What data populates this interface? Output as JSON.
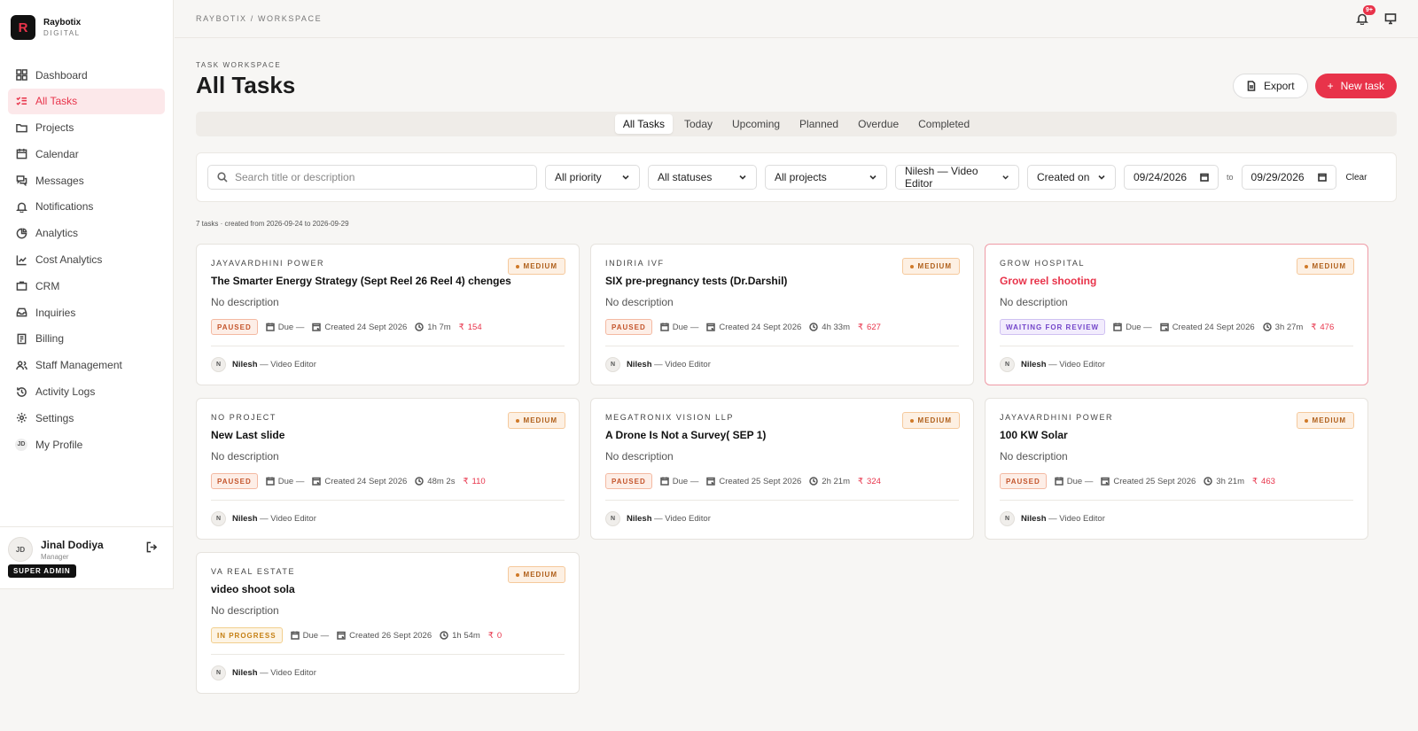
{
  "brand": {
    "logo_letter": "R",
    "name": "Raybotix",
    "sub": "DIGITAL"
  },
  "sidebar": {
    "items": [
      {
        "label": "Dashboard",
        "icon": "dashboard-icon"
      },
      {
        "label": "All Tasks",
        "icon": "tasks-icon",
        "active": true
      },
      {
        "label": "Projects",
        "icon": "folder-icon"
      },
      {
        "label": "Calendar",
        "icon": "calendar-icon"
      },
      {
        "label": "Messages",
        "icon": "messages-icon"
      },
      {
        "label": "Notifications",
        "icon": "bell-icon"
      },
      {
        "label": "Analytics",
        "icon": "analytics-icon"
      },
      {
        "label": "Cost Analytics",
        "icon": "cost-icon"
      },
      {
        "label": "CRM",
        "icon": "briefcase-icon"
      },
      {
        "label": "Inquiries",
        "icon": "inbox-icon"
      },
      {
        "label": "Billing",
        "icon": "billing-icon"
      },
      {
        "label": "Staff Management",
        "icon": "users-icon"
      },
      {
        "label": "Activity Logs",
        "icon": "history-icon"
      },
      {
        "label": "Settings",
        "icon": "gear-icon"
      },
      {
        "label": "My Profile",
        "icon": "profile-avatar-icon",
        "initials": "JD"
      }
    ]
  },
  "user": {
    "initials": "JD",
    "name": "Jinal Dodiya",
    "role": "Manager",
    "badge": "SUPER ADMIN"
  },
  "topbar": {
    "breadcrumb": "RAYBOTIX / WORKSPACE",
    "notif_count": "9+"
  },
  "page": {
    "eyebrow": "TASK WORKSPACE",
    "title": "All Tasks"
  },
  "actions": {
    "export": "Export",
    "new_task": "New task"
  },
  "tabs": [
    {
      "label": "All Tasks",
      "active": true
    },
    {
      "label": "Today"
    },
    {
      "label": "Upcoming"
    },
    {
      "label": "Planned"
    },
    {
      "label": "Overdue"
    },
    {
      "label": "Completed"
    }
  ],
  "filters": {
    "search_placeholder": "Search title or description",
    "priority": "All priority",
    "status": "All statuses",
    "project": "All projects",
    "assignee": "Nilesh — Video Editor",
    "date_field": "Created on",
    "date_from": "09/24/2026",
    "to": "to",
    "date_to": "09/29/2026",
    "clear": "Clear"
  },
  "summary": "7 tasks · created from 2026-09-24 to 2026-09-29",
  "tasks": [
    {
      "project": "JAYAVARDHINI POWER",
      "priority": "MEDIUM",
      "title": "The Smarter Energy Strategy (Sept Reel 26 Reel 4) chenges",
      "description": "No description",
      "status": "PAUSED",
      "due": "Due —",
      "created": "Created 24 Sept 2026",
      "time": "1h 7m",
      "amount": "154",
      "assignee_initial": "N",
      "assignee_name": "Nilesh",
      "assignee_role": "— Video Editor"
    },
    {
      "project": "INDIRIA IVF",
      "priority": "MEDIUM",
      "title": "SIX pre-pregnancy tests (Dr.Darshil)",
      "description": "No description",
      "status": "PAUSED",
      "due": "Due —",
      "created": "Created 24 Sept 2026",
      "time": "4h 33m",
      "amount": "627",
      "assignee_initial": "N",
      "assignee_name": "Nilesh",
      "assignee_role": "— Video Editor"
    },
    {
      "project": "GROW HOSPITAL",
      "priority": "MEDIUM",
      "title": "Grow reel shooting",
      "description": "No description",
      "status": "WAITING FOR REVIEW",
      "due": "Due —",
      "created": "Created 24 Sept 2026",
      "time": "3h 27m",
      "amount": "476",
      "assignee_initial": "N",
      "assignee_name": "Nilesh",
      "assignee_role": "— Video Editor"
    },
    {
      "project": "NO PROJECT",
      "priority": "MEDIUM",
      "title": "New Last slide",
      "description": "No description",
      "status": "PAUSED",
      "due": "Due —",
      "created": "Created 24 Sept 2026",
      "time": "48m 2s",
      "amount": "110",
      "assignee_initial": "N",
      "assignee_name": "Nilesh",
      "assignee_role": "— Video Editor"
    },
    {
      "project": "MEGATRONIX VISION LLP",
      "priority": "MEDIUM",
      "title": "A Drone Is Not a Survey( SEP 1)",
      "description": "No description",
      "status": "PAUSED",
      "due": "Due —",
      "created": "Created 25 Sept 2026",
      "time": "2h 21m",
      "amount": "324",
      "assignee_initial": "N",
      "assignee_name": "Nilesh",
      "assignee_role": "— Video Editor"
    },
    {
      "project": "JAYAVARDHINI POWER",
      "priority": "MEDIUM",
      "title": "100 KW Solar",
      "description": "No description",
      "status": "PAUSED",
      "due": "Due —",
      "created": "Created 25 Sept 2026",
      "time": "3h 21m",
      "amount": "463",
      "assignee_initial": "N",
      "assignee_name": "Nilesh",
      "assignee_role": "— Video Editor"
    },
    {
      "project": "VA REAL ESTATE",
      "priority": "MEDIUM",
      "title": "video shoot sola",
      "description": "No description",
      "status": "IN PROGRESS",
      "due": "Due —",
      "created": "Created 26 Sept 2026",
      "time": "1h 54m",
      "amount": "0",
      "assignee_initial": "N",
      "assignee_name": "Nilesh",
      "assignee_role": "— Video Editor"
    }
  ],
  "currency_symbol": "₹",
  "colors": {
    "accent": "#e8334a",
    "background": "#f7f6f4"
  }
}
